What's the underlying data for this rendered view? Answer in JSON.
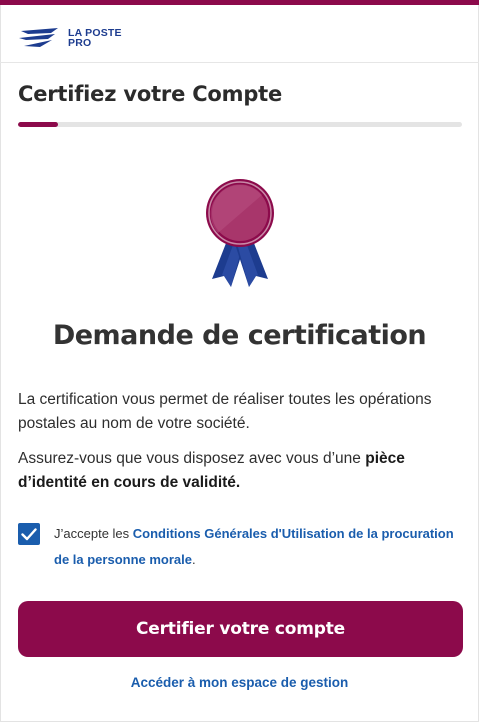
{
  "brand": {
    "line1": "LA POSTE",
    "line2": "PRO",
    "logo_icon": "la-poste-bird-icon",
    "color": "#1d3c8f"
  },
  "accent_color": "#8c0a4b",
  "link_color": "#1a5dad",
  "header": {
    "title": "Certifiez votre Compte"
  },
  "progress": {
    "percent": 9
  },
  "badge": {
    "icon": "certification-ribbon-icon"
  },
  "main": {
    "heading": "Demande de certification",
    "paragraph1": "La certification vous permet de réaliser toutes les opérations postales au nom de votre société.",
    "paragraph2_prefix": "Assurez-vous que vous disposez avec vous d’une ",
    "paragraph2_strong": "pièce d’identité en cours de validité.",
    "consent": {
      "checked": true,
      "prefix": "J’accepte les ",
      "link": "Conditions Générales d'Utilisation de la procuration de la personne morale",
      "suffix": "."
    },
    "primary_button": "Certifier votre compte",
    "secondary_link": "Accéder à mon espace de gestion"
  }
}
